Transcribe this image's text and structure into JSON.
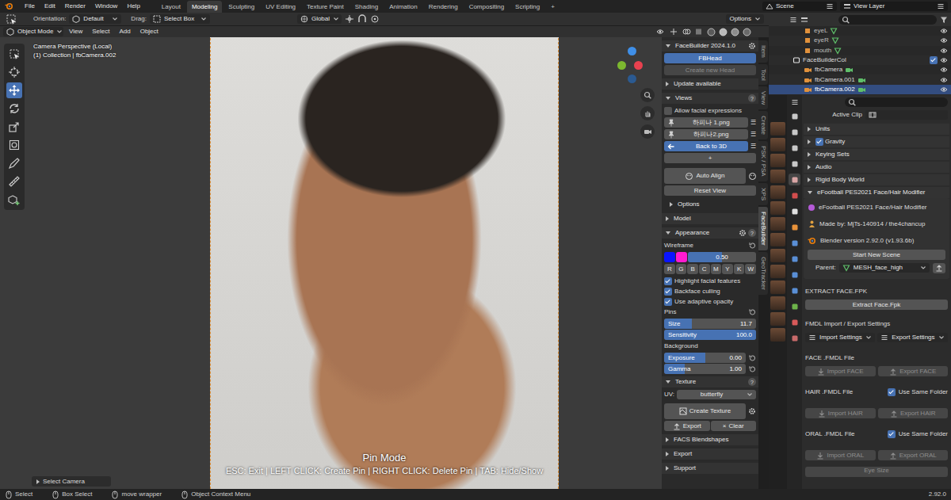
{
  "topbar": {
    "menus": [
      "File",
      "Edit",
      "Render",
      "Window",
      "Help"
    ],
    "workspaces": [
      {
        "label": "Layout",
        "selected": false
      },
      {
        "label": "Modeling",
        "selected": true
      },
      {
        "label": "Sculpting",
        "selected": false
      },
      {
        "label": "UV Editing",
        "selected": false
      },
      {
        "label": "Texture Paint",
        "selected": false
      },
      {
        "label": "Shading",
        "selected": false
      },
      {
        "label": "Animation",
        "selected": false
      },
      {
        "label": "Rendering",
        "selected": false
      },
      {
        "label": "Compositing",
        "selected": false
      },
      {
        "label": "Scripting",
        "selected": false
      }
    ],
    "add_workspace": "+",
    "scene": "Scene",
    "view_layer": "View Layer"
  },
  "tool_settings": {
    "orientation_label": "Orientation:",
    "orientation": "Default",
    "drag_label": "Drag:",
    "drag": "Select Box",
    "transform": "Global",
    "options": "Options"
  },
  "viewport": {
    "mode": "Object Mode",
    "menus": [
      "View",
      "Select",
      "Add",
      "Object"
    ],
    "camera_title": "Camera Perspective (Local)",
    "camera_subtitle": "(1) Collection | fbCamera.002",
    "overlay_title": "Pin Mode",
    "overlay_hint": "ESC: Exit | LEFT CLICK: Create Pin | RIGHT CLICK: Delete Pin | TAB: Hide/Show",
    "last_operator": {
      "label": "Select Camera",
      "expanded": false
    }
  },
  "tools": [
    {
      "kind": "select",
      "selected": false
    },
    {
      "kind": "cursor",
      "selected": false
    },
    {
      "kind": "move",
      "selected": true
    },
    {
      "kind": "rotate",
      "selected": false
    },
    {
      "kind": "scale",
      "selected": false
    },
    {
      "kind": "transform",
      "selected": false
    },
    {
      "kind": "annotate",
      "selected": false
    },
    {
      "kind": "measure",
      "selected": false
    },
    {
      "kind": "add",
      "selected": false
    }
  ],
  "gizmo_axes": [
    {
      "color": "#3f8fe8"
    },
    {
      "color": "#7cb82f"
    },
    {
      "color": "#e8414f"
    },
    {
      "color": "#2b5a91"
    }
  ],
  "sidebar_tabs": [
    {
      "label": "Item",
      "selected": false
    },
    {
      "label": "Tool",
      "selected": false
    },
    {
      "label": "View",
      "selected": false
    },
    {
      "label": "Create",
      "selected": false
    },
    {
      "label": "PSK / PSA",
      "selected": false
    },
    {
      "label": "XPS",
      "selected": false
    },
    {
      "label": "FaceBuilder",
      "selected": true
    },
    {
      "label": "GeoTracker",
      "selected": false
    }
  ],
  "facebuilder": {
    "title": "FaceBuilder 2024.1.0",
    "expanded": true,
    "heads": [
      {
        "label": "FBHead",
        "selected": true,
        "disabled": false
      },
      {
        "label": "Create new Head",
        "selected": false,
        "disabled": true
      }
    ],
    "update": {
      "label": "Update available",
      "expanded": false
    },
    "views": {
      "label": "Views",
      "expanded": true,
      "help": "?",
      "allow_expressions": {
        "label": "Allow facial expressions",
        "checked": false
      },
      "items": [
        {
          "label": "하피나 1.png",
          "selected": false,
          "kind": "pinned"
        },
        {
          "label": "하피나2.png",
          "selected": false,
          "kind": "pinned"
        },
        {
          "label": "Back to 3D",
          "selected": true,
          "kind": "back"
        }
      ],
      "menu_icon": "☰",
      "add": "+",
      "auto_align": "Auto Align",
      "reset_view": "Reset View",
      "options": {
        "label": "Options",
        "expanded": false
      }
    },
    "model": {
      "label": "Model",
      "expanded": false
    },
    "appearance": {
      "label": "Appearance",
      "expanded": true,
      "help": "?",
      "wireframe_label": "Wireframe",
      "wire_colors": [
        {
          "color": "#0a14ff"
        },
        {
          "color": "#ff1ad0"
        }
      ],
      "opacity": {
        "reading": "0.50",
        "level": 0.5
      },
      "presets": [
        "R",
        "G",
        "B",
        "C",
        "M",
        "Y",
        "K",
        "W"
      ],
      "checks": [
        {
          "label": "Highlight facial features",
          "checked": true
        },
        {
          "label": "Backface culling",
          "checked": true
        },
        {
          "label": "Use adaptive opacity",
          "checked": true
        }
      ],
      "pins_label": "Pins",
      "pins": [
        {
          "label": "Size",
          "reading": "11.7",
          "level": 0.3
        },
        {
          "label": "Sensitivity",
          "reading": "100.0",
          "level": 1
        }
      ],
      "background_label": "Background",
      "background": [
        {
          "label": "Exposure",
          "reading": "0.00",
          "level": 0.5
        },
        {
          "label": "Gamma",
          "reading": "1.00",
          "level": 0.25
        }
      ]
    },
    "texture": {
      "label": "Texture",
      "expanded": true,
      "help": "?",
      "uv_label": "UV:",
      "uv": "butterfly",
      "create": "Create Texture",
      "export": "Export",
      "clear": "Clear",
      "clear_icon": "×"
    },
    "collapsed": [
      {
        "label": "FACS Blendshapes",
        "expanded": false
      },
      {
        "label": "Export",
        "expanded": false
      },
      {
        "label": "Support",
        "expanded": false
      }
    ]
  },
  "outliner": {
    "items": [
      {
        "label": "eyeL",
        "kind": "mesh",
        "selected": false
      },
      {
        "label": "eyeR",
        "kind": "mesh",
        "selected": false
      },
      {
        "label": "mouth",
        "kind": "mesh",
        "selected": false
      },
      {
        "label": "FaceBuilderCol",
        "kind": "collection",
        "selected": false,
        "checked": true
      },
      {
        "label": "fbCamera",
        "kind": "camera",
        "selected": false
      },
      {
        "label": "fbCamera.001",
        "kind": "camera",
        "selected": false
      },
      {
        "label": "fbCamera.002",
        "kind": "camera",
        "selected": true
      }
    ]
  },
  "property_tabs": [
    {
      "color": "#c8c8c8",
      "selected": false
    },
    {
      "color": "#c8c8c8",
      "selected": false
    },
    {
      "color": "#c8c8c8",
      "selected": false
    },
    {
      "color": "#c8c8c8",
      "selected": false
    },
    {
      "color": "#d9a5a5",
      "selected": true
    },
    {
      "color": "#d24d4d",
      "selected": false
    },
    {
      "color": "#e0e0e0",
      "selected": false
    },
    {
      "color": "#e8923a",
      "selected": false
    },
    {
      "color": "#5a8fd6",
      "selected": false
    },
    {
      "color": "#5a8fd6",
      "selected": false
    },
    {
      "color": "#5a8fd6",
      "selected": false
    },
    {
      "color": "#5a8fd6",
      "selected": false
    },
    {
      "color": "#6db34a",
      "selected": false
    },
    {
      "color": "#d85a5a",
      "selected": false
    },
    {
      "color": "#c86a6a",
      "selected": false
    }
  ],
  "properties": {
    "active_clip_label": "Active Clip",
    "sections": [
      {
        "label": "Units",
        "kind": "plain",
        "expanded": false
      },
      {
        "label": "Gravity",
        "kind": "check",
        "checked": true,
        "expanded": false
      },
      {
        "label": "Keying Sets",
        "kind": "plain",
        "expanded": false
      },
      {
        "label": "Audio",
        "kind": "plain",
        "expanded": false
      },
      {
        "label": "Rigid Body World",
        "kind": "plain",
        "expanded": false
      }
    ],
    "addon": {
      "header": "eFootball PES2021 Face/Hair Modifier",
      "expanded": true,
      "title": "eFootball PES2021 Face/Hair Modifier",
      "author": "Made by: MjTs-140914 / the4chancup",
      "version": "Blender version 2.92.0 (v1.93.6b)",
      "start": "Start New Scene",
      "parent_label": "Parent:",
      "parent": "MESH_face_high",
      "extract_label": "EXTRACT FACE.FPK",
      "extract": "Extract Face.Fpk",
      "settings_label": "FMDL Import / Export Settings",
      "import_settings": "Import Settings",
      "export_settings": "Export Settings",
      "files": [
        {
          "label": "FACE .FMDL File",
          "kind": "plain",
          "import": {
            "label": "Import FACE",
            "disabled": true
          },
          "export": {
            "label": "Export FACE",
            "disabled": true
          }
        },
        {
          "label": "HAIR .FMDL File",
          "kind": "option",
          "option": {
            "label": "Use Same Folder",
            "checked": true
          },
          "import": {
            "label": "Import HAIR",
            "disabled": true
          },
          "export": {
            "label": "Export HAIR",
            "disabled": true
          }
        },
        {
          "label": "ORAL .FMDL File",
          "kind": "option",
          "option": {
            "label": "Use Same Folder",
            "checked": true
          },
          "import": {
            "label": "Import ORAL",
            "disabled": true
          },
          "export": {
            "label": "Export ORAL",
            "disabled": true
          }
        }
      ],
      "eye_size": {
        "label": "Eye Size",
        "disabled": true
      }
    }
  },
  "status_bar": {
    "items": [
      "Select",
      "Box Select",
      "move wrapper",
      "Object Context Menu"
    ],
    "version": "2.92.0"
  }
}
